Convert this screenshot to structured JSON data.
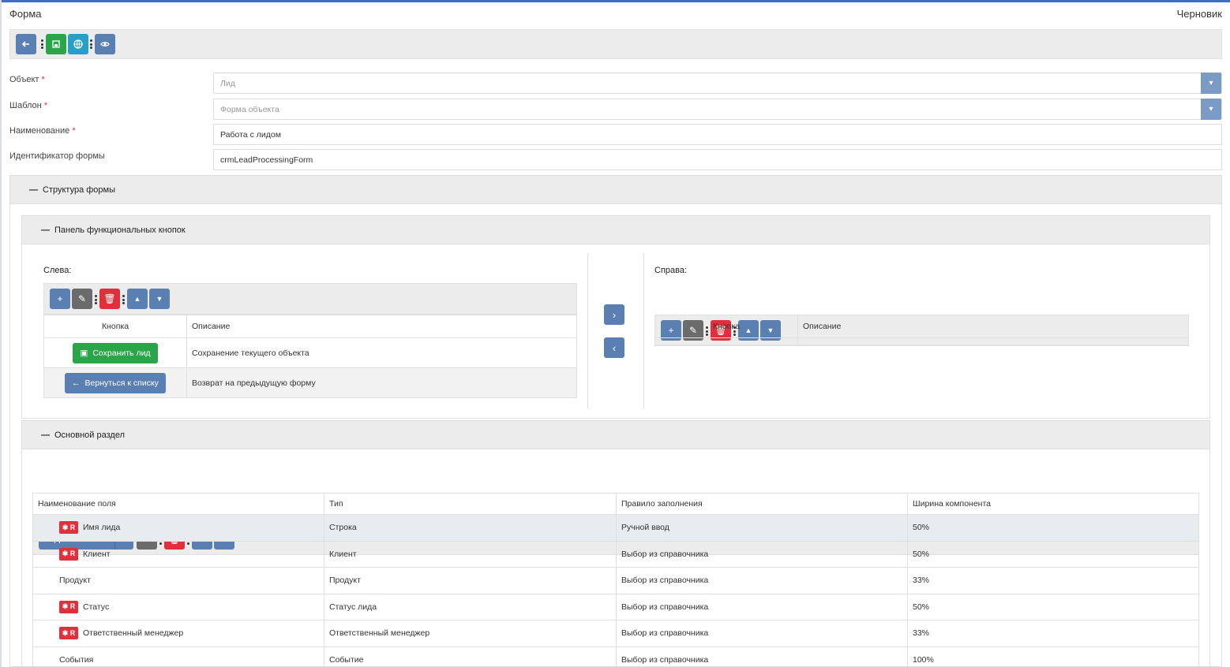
{
  "header": {
    "title": "Форма",
    "status": "Черновик"
  },
  "fields": {
    "object": {
      "label": "Объект",
      "required": "*",
      "value": "Лид"
    },
    "template": {
      "label": "Шаблон",
      "required": "*",
      "value": "Форма объекта"
    },
    "name": {
      "label": "Наименование",
      "required": "*",
      "value": "Работа с лидом"
    },
    "form_id": {
      "label": "Идентификатор формы",
      "value": "crmLeadProcessingForm"
    }
  },
  "structure": {
    "title": "Структура формы",
    "collapse": "—"
  },
  "buttons_panel": {
    "title": "Панель функциональных кнопок",
    "left": {
      "label": "Слева:",
      "col_button": "Кнопка",
      "col_desc": "Описание",
      "rows": [
        {
          "button": "Сохранить лид",
          "desc": "Сохранение текущего объекта"
        },
        {
          "button": "Вернуться к списку",
          "desc": "Возврат на предыдущую форму"
        }
      ]
    },
    "right": {
      "label": "Справа:",
      "col_button": "Кнопка",
      "col_desc": "Описание"
    }
  },
  "main_section": {
    "title": "Основной раздел",
    "add_label": "Добавить",
    "columns": [
      "Наименование поля",
      "Тип",
      "Правило заполнения",
      "Ширина компонента"
    ],
    "required_badge": "✱ R",
    "rows": [
      {
        "name": "Имя лида",
        "required": true,
        "type": "Строка",
        "rule": "Ручной ввод",
        "width": "50%"
      },
      {
        "name": "Клиент",
        "required": true,
        "type": "Клиент",
        "rule": "Выбор из справочника",
        "width": "50%"
      },
      {
        "name": "Продукт",
        "required": false,
        "type": "Продукт",
        "rule": "Выбор из справочника",
        "width": "33%"
      },
      {
        "name": "Статус",
        "required": true,
        "type": "Статус лида",
        "rule": "Выбор из справочника",
        "width": "50%"
      },
      {
        "name": "Ответственный менеджер",
        "required": true,
        "type": "Ответственный менеджер",
        "rule": "Выбор из справочника",
        "width": "33%"
      },
      {
        "name": "События",
        "required": false,
        "type": "Событие",
        "rule": "Выбор из справочника",
        "width": "100%"
      }
    ]
  },
  "colors": {
    "blue": "#5a7fb3",
    "green": "#2aa54a",
    "teal": "#27a0c7",
    "red": "#e0303c",
    "gray": "#6b6b6b"
  }
}
